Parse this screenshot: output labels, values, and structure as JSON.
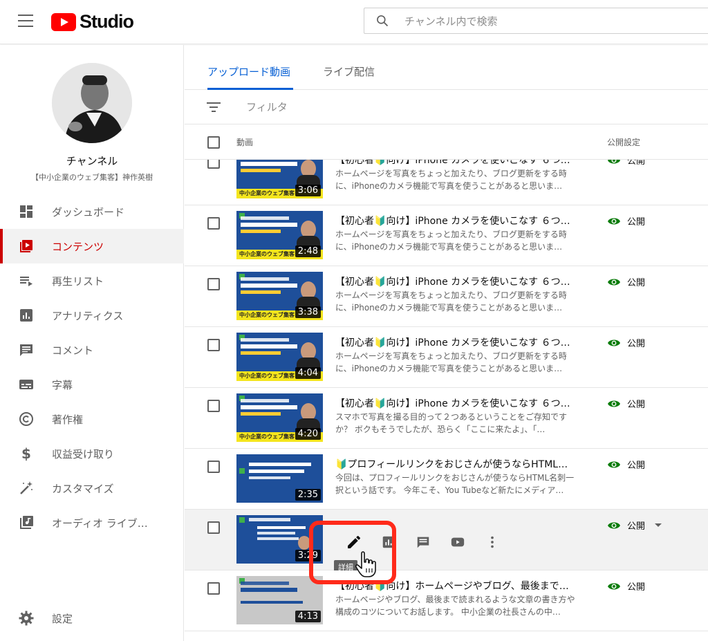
{
  "app": {
    "brand": "Studio",
    "accent": "#cc0000",
    "link_color": "#065fd4"
  },
  "search": {
    "placeholder": "チャンネル内で検索"
  },
  "channel": {
    "name": "チャンネル",
    "subtitle": "【中小企業のウェブ集客】神作英樹"
  },
  "sidebar": {
    "items": [
      {
        "label": "ダッシュボード",
        "icon": "dashboard-icon",
        "active": false
      },
      {
        "label": "コンテンツ",
        "icon": "content-icon",
        "active": true
      },
      {
        "label": "再生リスト",
        "icon": "playlist-icon",
        "active": false
      },
      {
        "label": "アナリティクス",
        "icon": "analytics-icon",
        "active": false
      },
      {
        "label": "コメント",
        "icon": "comment-icon",
        "active": false
      },
      {
        "label": "字幕",
        "icon": "subtitles-icon",
        "active": false
      },
      {
        "label": "著作権",
        "icon": "copyright-icon",
        "active": false
      },
      {
        "label": "収益受け取り",
        "icon": "dollar-icon",
        "active": false
      },
      {
        "label": "カスタマイズ",
        "icon": "magic-wand-icon",
        "active": false
      },
      {
        "label": "オーディオ ライブ…",
        "icon": "audio-library-icon",
        "active": false
      }
    ],
    "settings_label": "設定"
  },
  "tabs": [
    {
      "label": "アップロード動画",
      "active": true
    },
    {
      "label": "ライブ配信",
      "active": false
    }
  ],
  "filter": {
    "label": "フィルタ"
  },
  "table": {
    "col_video": "動画",
    "col_visibility": "公開設定",
    "rows": [
      {
        "title": "【初心者🔰向け】iPhone カメラを使いこなす ６つの撮…",
        "desc": "ホームページを写真をちょっと加えたり、ブログ更新をする時に、iPhoneのカメラ機能で写真を使うことがあると思いま…",
        "duration": "3:06",
        "visibility": "公開",
        "thumb_caption": "中小企業のウェブ集客"
      },
      {
        "title": "【初心者🔰向け】iPhone カメラを使いこなす ６つの撮…",
        "desc": "ホームページを写真をちょっと加えたり、ブログ更新をする時に、iPhoneのカメラ機能で写真を使うことがあると思いま…",
        "duration": "2:48",
        "visibility": "公開",
        "thumb_caption": "中小企業のウェブ集客"
      },
      {
        "title": "【初心者🔰向け】iPhone カメラを使いこなす ６つの撮…",
        "desc": "ホームページを写真をちょっと加えたり、ブログ更新をする時に、iPhoneのカメラ機能で写真を使うことがあると思いま…",
        "duration": "3:38",
        "visibility": "公開",
        "thumb_caption": "中小企業のウェブ集客"
      },
      {
        "title": "【初心者🔰向け】iPhone カメラを使いこなす ６つの撮…",
        "desc": "ホームページを写真をちょっと加えたり、ブログ更新をする時に、iPhoneのカメラ機能で写真を使うことがあると思いま…",
        "duration": "4:04",
        "visibility": "公開",
        "thumb_caption": "中小企業のウェブ集客"
      },
      {
        "title": "【初心者🔰向け】iPhone カメラを使いこなす ６つの撮…",
        "desc": "スマホで写真を撮る目的って２つあるということをご存知ですか？ ボクもそうでしたが、恐らく「ここに来たよ」、「…",
        "duration": "4:20",
        "visibility": "公開",
        "thumb_caption": "中小企業のウェブ集客"
      },
      {
        "title": "🔰プロフィールリンクをおじさんが使うならHTML名刺…",
        "desc": "今回は、プロフィールリンクをおじさんが使うならHTML名刺一択という話です。 今年こそ、You Tubeなど新たにメディア…",
        "duration": "2:35",
        "visibility": "公開",
        "thumb_caption": ""
      },
      {
        "title": "",
        "desc": "",
        "duration": "3:29",
        "visibility": "公開",
        "thumb_caption": ""
      },
      {
        "title": "【初心者🔰向け】ホームページやブログ、最後まで読ま…",
        "desc": "ホームページやブログ、最後まで読まれるような文章の書き方や構成のコツについてお話します。 中小企業の社長さんの中…",
        "duration": "4:13",
        "visibility": "公開",
        "thumb_caption": ""
      }
    ]
  },
  "hover_actions": {
    "tooltip": "詳細",
    "icons": [
      "pencil-icon",
      "analytics-icon",
      "comment-icon",
      "youtube-icon",
      "more-vert-icon"
    ]
  }
}
